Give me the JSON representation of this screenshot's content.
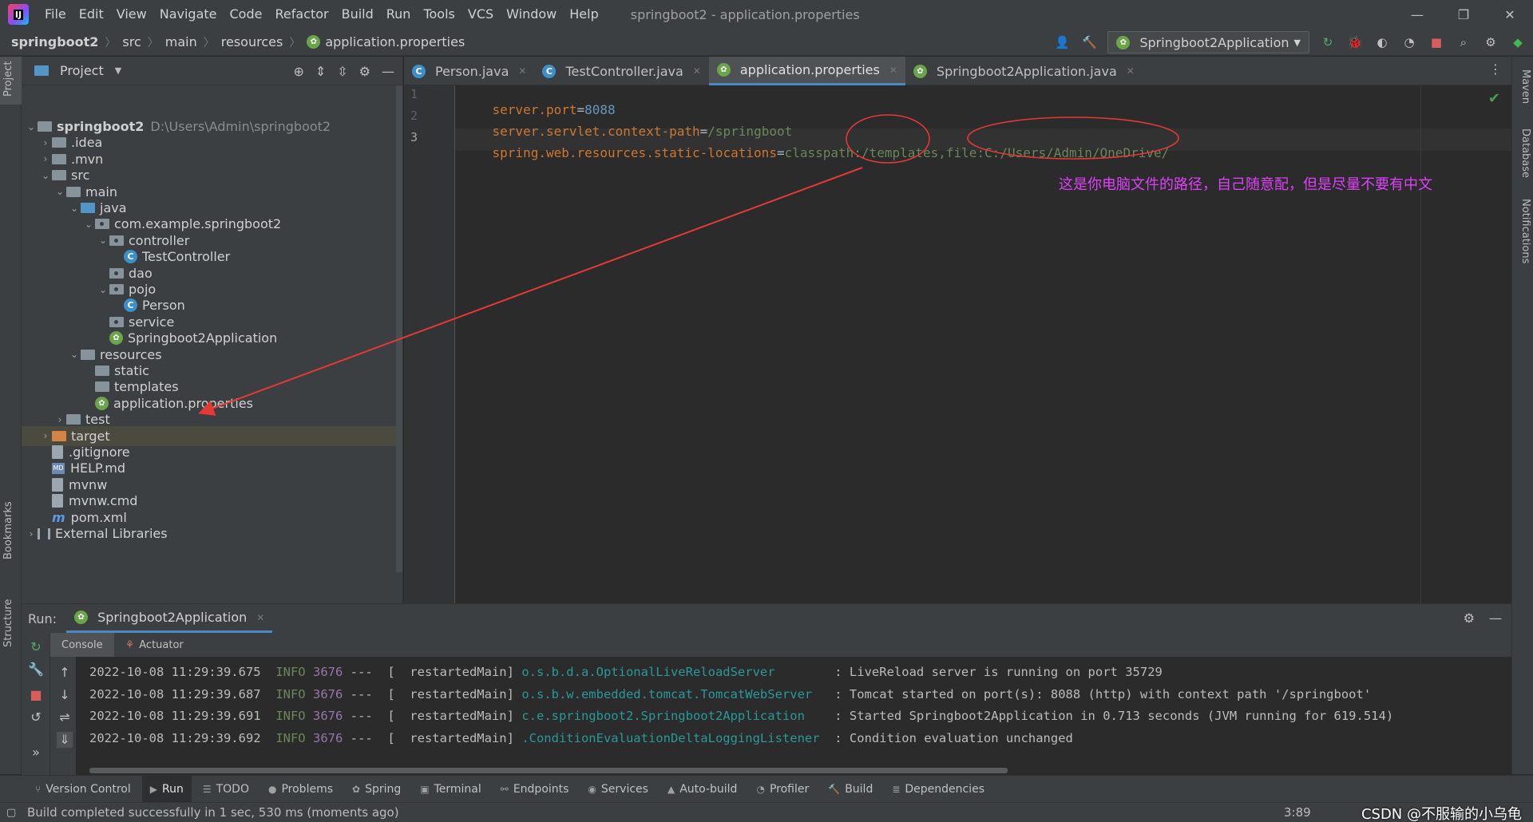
{
  "menubar": {
    "items": [
      "File",
      "Edit",
      "View",
      "Navigate",
      "Code",
      "Refactor",
      "Build",
      "Run",
      "Tools",
      "VCS",
      "Window",
      "Help"
    ],
    "window_title": "springboot2 - application.properties"
  },
  "breadcrumb": [
    "springboot2",
    "src",
    "main",
    "resources",
    "application.properties"
  ],
  "toolbar": {
    "run_config": "Springboot2Application"
  },
  "left_strip": {
    "project": "Project",
    "bookmarks": "Bookmarks",
    "structure": "Structure"
  },
  "right_strip": {
    "maven": "Maven",
    "database": "Database",
    "notifications": "Notifications"
  },
  "project_panel": {
    "title": "Project",
    "tree": [
      {
        "label": "springboot2",
        "path": "D:\\Users\\Admin\\springboot2"
      },
      {
        "label": ".idea"
      },
      {
        "label": ".mvn"
      },
      {
        "label": "src"
      },
      {
        "label": "main"
      },
      {
        "label": "java"
      },
      {
        "label": "com.example.springboot2"
      },
      {
        "label": "controller"
      },
      {
        "label": "TestController"
      },
      {
        "label": "dao"
      },
      {
        "label": "pojo"
      },
      {
        "label": "Person"
      },
      {
        "label": "service"
      },
      {
        "label": "Springboot2Application"
      },
      {
        "label": "resources"
      },
      {
        "label": "static"
      },
      {
        "label": "templates"
      },
      {
        "label": "application.properties"
      },
      {
        "label": "test"
      },
      {
        "label": "target"
      },
      {
        "label": ".gitignore"
      },
      {
        "label": "HELP.md"
      },
      {
        "label": "mvnw"
      },
      {
        "label": "mvnw.cmd"
      },
      {
        "label": "pom.xml"
      },
      {
        "label": "External Libraries"
      }
    ]
  },
  "editor_tabs": [
    "Person.java",
    "TestController.java",
    "application.properties",
    "Springboot2Application.java"
  ],
  "editor": {
    "line_numbers": [
      "1",
      "2",
      "3"
    ],
    "lines": [
      {
        "key": "server.port",
        "value": "8088"
      },
      {
        "key": "server.servlet.context-path",
        "value": "/springboot"
      },
      {
        "key": "spring.web.resources.static-locations",
        "value": "classpath:/templates,file:C:/Users/Admin/OneDrive/"
      }
    ],
    "annotation": "这是你电脑文件的路径，自己随意配，但是尽量不要有中文"
  },
  "run_panel": {
    "label": "Run:",
    "tab": "Springboot2Application",
    "console_tabs": [
      "Console",
      "Actuator"
    ],
    "log": [
      {
        "ts": "2022-10-08 11:29:39.675",
        "level": "INFO",
        "pid": "3676",
        "thread": "---  [  restartedMain]",
        "cls": "o.s.b.d.a.OptionalLiveReloadServer       ",
        "msg": ": LiveReload server is running on port 35729"
      },
      {
        "ts": "2022-10-08 11:29:39.687",
        "level": "INFO",
        "pid": "3676",
        "thread": "---  [  restartedMain]",
        "cls": "o.s.b.w.embedded.tomcat.TomcatWebServer  ",
        "msg": ": Tomcat started on port(s): 8088 (http) with context path '/springboot'"
      },
      {
        "ts": "2022-10-08 11:29:39.691",
        "level": "INFO",
        "pid": "3676",
        "thread": "---  [  restartedMain]",
        "cls": "c.e.springboot2.Springboot2Application   ",
        "msg": ": Started Springboot2Application in 0.713 seconds (JVM running for 619.514)"
      },
      {
        "ts": "2022-10-08 11:29:39.692",
        "level": "INFO",
        "pid": "3676",
        "thread": "---  [  restartedMain]",
        "cls": ".ConditionEvaluationDeltaLoggingListener ",
        "msg": ": Condition evaluation unchanged"
      }
    ]
  },
  "bottom_tabs": [
    "Version Control",
    "Run",
    "TODO",
    "Problems",
    "Spring",
    "Terminal",
    "Endpoints",
    "Services",
    "Auto-build",
    "Profiler",
    "Build",
    "Dependencies"
  ],
  "status": {
    "message": "Build completed successfully in 1 sec, 530 ms (moments ago)",
    "position": "3:89",
    "watermark": "CSDN @不服输的小乌龟"
  }
}
